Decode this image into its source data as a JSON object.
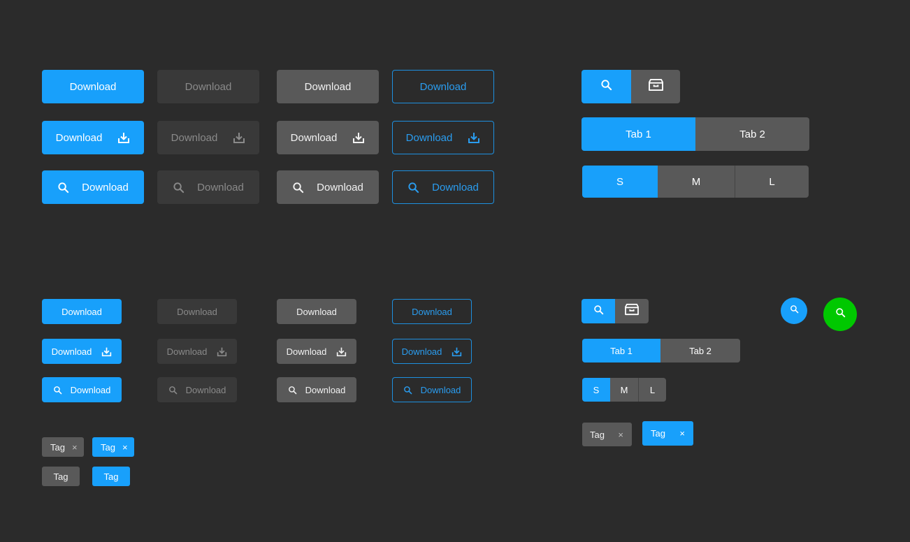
{
  "colors": {
    "background": "#2b2b2b",
    "primary": "#18a0fb",
    "secondary": "#595959",
    "disabled": "#393939",
    "outline": "#1e90e0",
    "success": "#00c800"
  },
  "large_buttons": {
    "row1": {
      "primary": "Download",
      "disabled": "Download",
      "secondary": "Download",
      "outline": "Download"
    },
    "row2": {
      "primary": "Download",
      "disabled": "Download",
      "secondary": "Download",
      "outline": "Download",
      "icon": "download-icon"
    },
    "row3": {
      "primary": "Download",
      "disabled": "Download",
      "secondary": "Download",
      "outline": "Download",
      "icon": "search-icon"
    }
  },
  "small_buttons": {
    "row1": {
      "primary": "Download",
      "disabled": "Download",
      "secondary": "Download",
      "outline": "Download"
    },
    "row2": {
      "primary": "Download",
      "disabled": "Download",
      "secondary": "Download",
      "outline": "Download",
      "icon": "download-icon"
    },
    "row3": {
      "primary": "Download",
      "disabled": "Download",
      "secondary": "Download",
      "outline": "Download",
      "icon": "search-icon"
    }
  },
  "large_controls": {
    "icon_toggle": [
      "search-icon",
      "archive-icon"
    ],
    "tabs": [
      "Tab 1",
      "Tab 2"
    ],
    "active_tab": "Tab 1",
    "sizes": [
      "S",
      "M",
      "L"
    ],
    "active_size": "S"
  },
  "small_controls": {
    "icon_toggle": [
      "search-icon",
      "archive-icon"
    ],
    "tabs": [
      "Tab 1",
      "Tab 2"
    ],
    "active_tab": "Tab 1",
    "sizes": [
      "S",
      "M",
      "L"
    ],
    "active_size": "S",
    "tags": [
      {
        "label": "Tag",
        "style": "grey",
        "closable": true,
        "close_glyph": "×"
      },
      {
        "label": "Tag",
        "style": "blue",
        "closable": true,
        "close_glyph": "×"
      }
    ]
  },
  "fabs": [
    {
      "icon": "search-icon",
      "color": "#18a0fb"
    },
    {
      "icon": "search-icon",
      "color": "#00c800"
    }
  ],
  "tags": [
    {
      "label": "Tag",
      "style": "grey",
      "closable": true,
      "close_glyph": "×"
    },
    {
      "label": "Tag",
      "style": "blue",
      "closable": true,
      "close_glyph": "×"
    },
    {
      "label": "Tag",
      "style": "grey",
      "closable": false
    },
    {
      "label": "Tag",
      "style": "blue",
      "closable": false
    }
  ]
}
